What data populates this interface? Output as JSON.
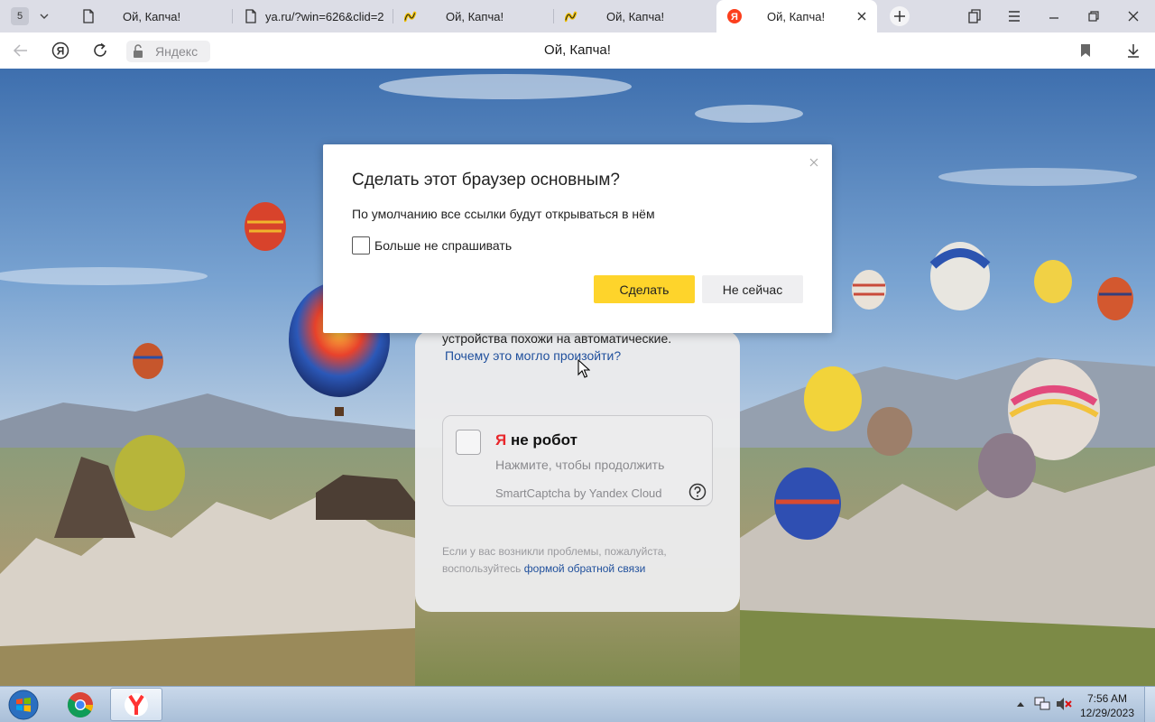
{
  "browser": {
    "tab_count": "5",
    "tabs": [
      {
        "label": "Ой, Капча!",
        "icon": "page-icon",
        "active": false
      },
      {
        "label": "ya.ru/?win=626&clid=2",
        "icon": "page-icon",
        "active": false
      },
      {
        "label": "Ой, Капча!",
        "icon": "yandex-market-icon",
        "active": false
      },
      {
        "label": "Ой, Капча!",
        "icon": "yandex-market-icon",
        "active": false
      },
      {
        "label": "Ой, Капча!",
        "icon": "yandex-icon",
        "active": true
      }
    ],
    "address_host": "Яндекс",
    "page_title": "Ой, Капча!"
  },
  "captcha": {
    "message": "устройства похожи на автоматические.",
    "why_link": "Почему это могло произойти?",
    "robot_title_ya": "Я",
    "robot_title_rest": " не робот",
    "robot_subtitle": "Нажмите, чтобы продолжить",
    "brand": "SmartCaptcha by Yandex Cloud",
    "footer_text": "Если у вас возникли проблемы, пожалуйста, воспользуйтесь",
    "footer_link": "формой обратной связи"
  },
  "dialog": {
    "title": "Сделать этот браузер основным?",
    "text": "По умолчанию все ссылки будут открываться в нём",
    "checkbox_label": "Больше не спрашивать",
    "primary_button": "Сделать",
    "secondary_button": "Не сейчас",
    "primary_color": "#fed42b"
  },
  "taskbar": {
    "time": "7:56 AM",
    "date": "12/29/2023"
  }
}
